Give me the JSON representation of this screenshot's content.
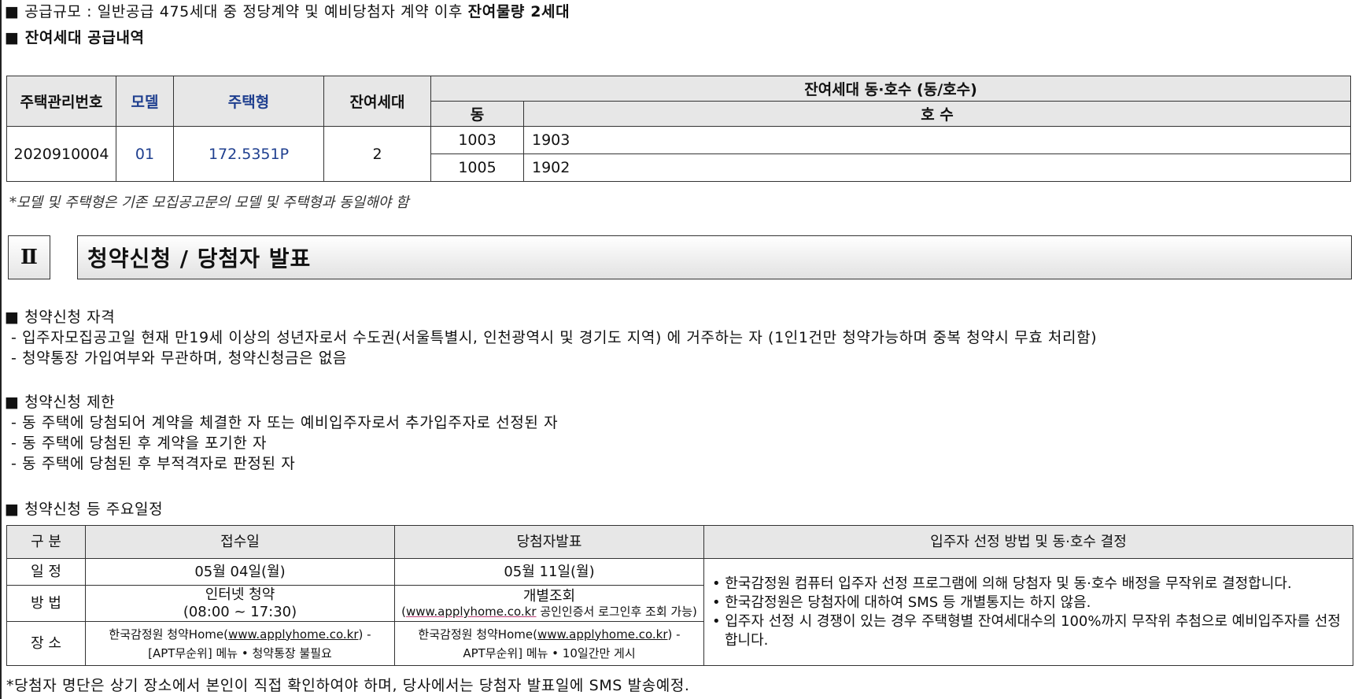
{
  "supply": {
    "scale_prefix": "■ 공급규모 : 일반공급 475세대 중 정당계약 및 예비당첨자 계약 이후 ",
    "scale_bold": "잔여물량 2세대",
    "remaining_heading": "■ 잔여세대 공급내역"
  },
  "supply_table": {
    "headers": {
      "mgmt_no": "주택관리번호",
      "model": "모델",
      "type": "주택형",
      "remaining": "잔여세대",
      "unit_group": "잔여세대 동·호수 (동/호수)",
      "dong": "동",
      "ho": "호 수"
    },
    "row": {
      "mgmt_no": "2020910004",
      "model": "01",
      "type": "172.5351P",
      "remaining": "2"
    },
    "units": [
      {
        "dong": "1003",
        "ho": "1903"
      },
      {
        "dong": "1005",
        "ho": "1902"
      }
    ],
    "footnote": "*모델 및 주택형은 기존 모집공고문의 모델 및 주택형과 동일해야 함"
  },
  "section2": {
    "number": "Ⅱ",
    "title": "청약신청 / 당첨자 발표"
  },
  "eligibility": {
    "heading": "■ 청약신청 자격",
    "items": [
      "- 입주자모집공고일 현재 만19세 이상의 성년자로서 수도권(서울특별시, 인천광역시 및 경기도 지역) 에 거주하는 자 (1인1건만 청약가능하며 중복 청약시 무효 처리함)",
      "- 청약통장 가입여부와 무관하며, 청약신청금은 없음"
    ]
  },
  "restriction": {
    "heading": "■ 청약신청 제한",
    "items": [
      "- 동 주택에 당첨되어 계약을 체결한 자 또는 예비입주자로서 추가입주자로 선정된 자",
      "- 동 주택에 당첨된 후 계약을 포기한 자",
      "- 동 주택에 당첨된 후 부적격자로 판정된 자"
    ]
  },
  "schedule": {
    "heading": "■ 청약신청 등 주요일정",
    "headers": {
      "category": "구  분",
      "receipt": "접수일",
      "announce": "당첨자발표",
      "method": "입주자 선정 방법 및 동·호수 결정"
    },
    "rows": {
      "date_label": "일  정",
      "date_receipt": "05월 04일(월)",
      "date_announce": "05월 11일(월)",
      "method_label": "방  법",
      "method_receipt_1": "인터넷 청약",
      "method_receipt_2": "(08:00 ~ 17:30)",
      "method_announce_1": "개별조회",
      "method_announce_url": "www.applyhome.co.kr",
      "method_announce_rest": " 공인인증서 로그인후 조회 가능)",
      "place_label": "장  소",
      "place_receipt_1a": "한국감정원 청약Home(",
      "place_receipt_url": "www.applyhome.co.kr",
      "place_receipt_1b": ") -",
      "place_receipt_2": "[APT무순위] 메뉴 • 청약통장 불필요",
      "place_announce_1a": "한국감정원 청약Home(",
      "place_announce_url": "www.applyhome.co.kr",
      "place_announce_1b": ") -",
      "place_announce_2": "APT무순위] 메뉴 • 10일간만 게시"
    },
    "method_items": [
      "• 한국감정원 컴퓨터 입주자 선정 프로그램에 의해 당첨자 및 동·호수 배정을 무작위로 결정합니다.",
      "• 한국감정원은 당첨자에 대하여 SMS 등 개별통지는 하지 않음.",
      "• 입주자 선정 시 경쟁이 있는 경우 주택형별 잔여세대수의 100%까지 무작위 추첨으로 예비입주자를 선정합니다."
    ],
    "footnote": "*당첨자 명단은 상기 장소에서 본인이 직접 확인하여야 하며, 당사에서는 당첨자 발표일에 SMS 발송예정."
  }
}
